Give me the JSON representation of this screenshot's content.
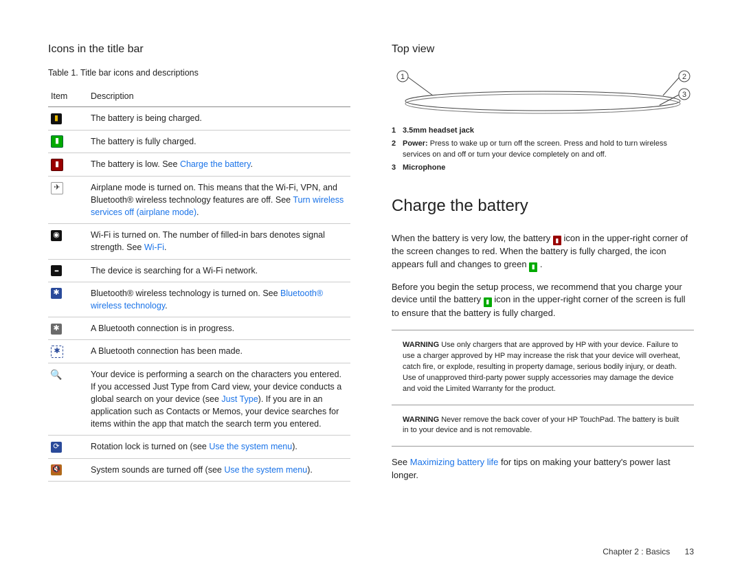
{
  "left": {
    "heading": "Icons in the title bar",
    "table_caption": "Table 1. Title bar icons and descriptions",
    "col_item": "Item",
    "col_desc": "Description",
    "rows": [
      {
        "icon": "charging",
        "glyph": "▮",
        "text": "The battery is being charged."
      },
      {
        "icon": "full",
        "glyph": "▮",
        "text": "The battery is fully charged."
      },
      {
        "icon": "low",
        "glyph": "▮",
        "pre": "The battery is low. See ",
        "link": "Charge the battery",
        "post": "."
      },
      {
        "icon": "airplane",
        "glyph": "✈",
        "text": "Airplane mode is turned on. This means that the Wi-Fi, VPN, and Bluetooth® wireless technology features are off. See ",
        "link": "Turn wireless services off (airplane mode)",
        "post": "."
      },
      {
        "icon": "wifi",
        "glyph": "◉",
        "text": "Wi-Fi is turned on. The number of filled-in bars denotes signal strength. See ",
        "link": "Wi-Fi",
        "post": "."
      },
      {
        "icon": "search-wifi",
        "glyph": "•••",
        "text": "The device is searching for a Wi-Fi network."
      },
      {
        "icon": "bt-on",
        "glyph": "✱",
        "text": "Bluetooth® wireless technology is turned on. See ",
        "link": "Bluetooth® wireless technology",
        "post": "."
      },
      {
        "icon": "bt-prog",
        "glyph": "✱",
        "text": "A Bluetooth connection is in progress."
      },
      {
        "icon": "bt-conn",
        "glyph": "✱",
        "text": "A Bluetooth connection has been made."
      },
      {
        "icon": "search",
        "glyph": "🔍",
        "text": "Your device is performing a search on the characters you entered. If you accessed Just Type from Card view, your device conducts a global search on your device (see ",
        "link": "Just Type",
        "post": "). If you are in an application such as Contacts or Memos, your device searches for items within the app that match the search term you entered."
      },
      {
        "icon": "rotlock",
        "glyph": "⟳",
        "pre": "Rotation lock is turned on (see ",
        "link": "Use the system menu",
        "post": ")."
      },
      {
        "icon": "mute",
        "glyph": "🔇",
        "pre": "System sounds are turned off (see ",
        "link": "Use the system menu",
        "post": ")."
      }
    ]
  },
  "right": {
    "topview_heading": "Top view",
    "callouts": [
      {
        "n": "1",
        "label": "3.5mm headset jack",
        "text": ""
      },
      {
        "n": "2",
        "label": "Power:",
        "text": " Press to wake up or turn off the screen. Press and hold to turn wireless services on and off or turn your device completely on and off."
      },
      {
        "n": "3",
        "label": "Microphone",
        "text": ""
      }
    ],
    "charge_heading": "Charge the battery",
    "p1a": "When the battery is very low, the battery ",
    "p1b": " icon in the upper-right corner of the screen changes to red. When the battery is fully charged, the icon appears full and changes to green ",
    "p1c": ".",
    "p2a": "Before you begin the setup process, we recommend that you charge your device until the battery ",
    "p2b": " icon in the upper-right corner of the screen is full to ensure that the battery is fully charged.",
    "warn_label": "WARNING",
    "warn1": " Use only chargers that are approved by HP with your device. Failure to use a charger approved by HP may increase the risk that your device will overheat, catch fire, or explode, resulting in property damage, serious bodily injury, or death. Use of unapproved third-party power supply accessories may damage the device and void the Limited Warranty for the product.",
    "warn2": " Never remove the back cover of your HP TouchPad. The battery is built in to your device and is not removable.",
    "tips_pre": "See ",
    "tips_link": "Maximizing battery life",
    "tips_post": " for tips on making your battery's power last longer."
  },
  "footer": {
    "chapter": "Chapter 2 : Basics",
    "page": "13"
  }
}
